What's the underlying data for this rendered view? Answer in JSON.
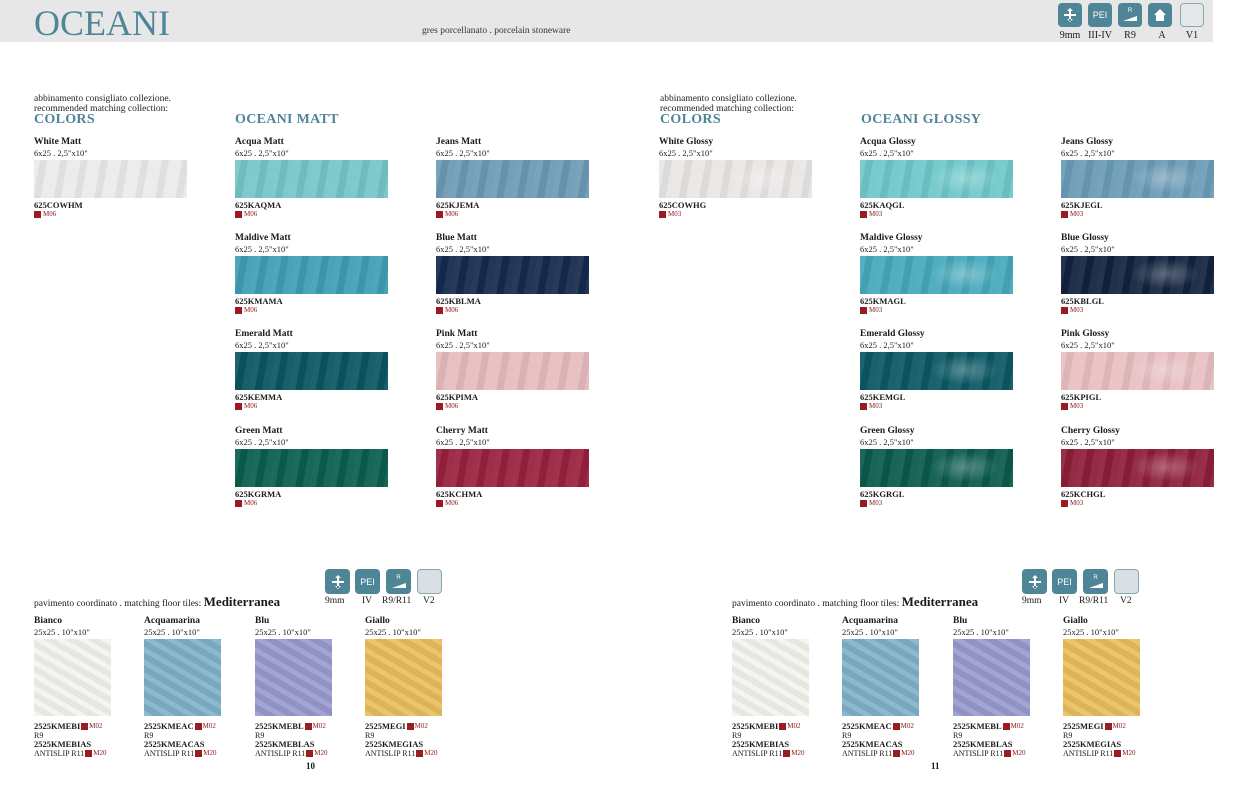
{
  "header": {
    "brand": "OCEANI",
    "subtitle": "gres porcellanato . porcelain stoneware",
    "specs": [
      {
        "icon": "thickness-icon",
        "label": "9mm"
      },
      {
        "icon": "pei-icon",
        "text": "PEI",
        "label": "III-IV"
      },
      {
        "icon": "slip-resistance-icon",
        "text": "R",
        "label": "R9"
      },
      {
        "icon": "frost-resistance-icon",
        "label": "A"
      },
      {
        "icon": "shade-variation-icon",
        "label": "V1"
      }
    ]
  },
  "left": {
    "suggest_line1": "abbinamento consigliato collezione.",
    "suggest_line2": "recommended matching collection:",
    "colors_title": "COLORS",
    "series_title": "OCEANI  MATT",
    "colors_tile": {
      "name": "White Matt",
      "size": "6x25 . 2,5\"x10\"",
      "code": "625COWHM",
      "finish": "M06",
      "color": "#ecebea"
    },
    "tiles": [
      {
        "name": "Acqua Matt",
        "size": "6x25 . 2,5\"x10\"",
        "code": "625KAQMA",
        "finish": "M06",
        "color": "#75c6c9"
      },
      {
        "name": "Jeans Matt",
        "size": "6x25 . 2,5\"x10\"",
        "code": "625KJEMA",
        "finish": "M06",
        "color": "#6e9ab5"
      },
      {
        "name": "Maldive Matt",
        "size": "6x25 . 2,5\"x10\"",
        "code": "625KMAMA",
        "finish": "M06",
        "color": "#3e9eb4"
      },
      {
        "name": "Blue Matt",
        "size": "6x25 . 2,5\"x10\"",
        "code": "625KBLMA",
        "finish": "M06",
        "color": "#16294e"
      },
      {
        "name": "Emerald Matt",
        "size": "6x25 . 2,5\"x10\"",
        "code": "625KEMMA",
        "finish": "M06",
        "color": "#0b5562"
      },
      {
        "name": "Pink Matt",
        "size": "6x25 . 2,5\"x10\"",
        "code": "625KPIMA",
        "finish": "M06",
        "color": "#e6bcbd"
      },
      {
        "name": "Green Matt",
        "size": "6x25 . 2,5\"x10\"",
        "code": "625KGRMA",
        "finish": "M06",
        "color": "#0a5e4f"
      },
      {
        "name": "Cherry Matt",
        "size": "6x25 . 2,5\"x10\"",
        "code": "625KCHMA",
        "finish": "M06",
        "color": "#99213f"
      }
    ]
  },
  "right": {
    "suggest_line1": "abbinamento consigliato collezione.",
    "suggest_line2": "recommended matching collection:",
    "colors_title": "COLORS",
    "series_title": "OCEANI  GLOSSY",
    "colors_tile": {
      "name": "White Glossy",
      "size": "6x25 . 2,5\"x10\"",
      "code": "625COWHG",
      "finish": "M03",
      "color": "#e9e7e5"
    },
    "tiles": [
      {
        "name": "Acqua Glossy",
        "size": "6x25 . 2,5\"x10\"",
        "code": "625KAQGL",
        "finish": "M03",
        "color": "#6fc8ca"
      },
      {
        "name": "Jeans Glossy",
        "size": "6x25 . 2,5\"x10\"",
        "code": "625KJEGL",
        "finish": "M03",
        "color": "#6b9bb6"
      },
      {
        "name": "Maldive Glossy",
        "size": "6x25 . 2,5\"x10\"",
        "code": "625KMAGL",
        "finish": "M03",
        "color": "#46a9bb"
      },
      {
        "name": "Blue Glossy",
        "size": "6x25 . 2,5\"x10\"",
        "code": "625KBLGL",
        "finish": "M03",
        "color": "#12233f"
      },
      {
        "name": "Emerald Glossy",
        "size": "6x25 . 2,5\"x10\"",
        "code": "625KEMGL",
        "finish": "M03",
        "color": "#0a5764"
      },
      {
        "name": "Pink Glossy",
        "size": "6x25 . 2,5\"x10\"",
        "code": "625KPIGL",
        "finish": "M03",
        "color": "#e8bfc2"
      },
      {
        "name": "Green Glossy",
        "size": "6x25 . 2,5\"x10\"",
        "code": "625KGRGL",
        "finish": "M03",
        "color": "#0a5a4c"
      },
      {
        "name": "Cherry Glossy",
        "size": "6x25 . 2,5\"x10\"",
        "code": "625KCHGL",
        "finish": "M03",
        "color": "#8e1d3a"
      }
    ]
  },
  "floor": {
    "caption": "pavimento coordinato . matching floor tiles:",
    "collection": "Mediterranea",
    "specs": [
      {
        "icon": "thickness-icon",
        "label": "9mm"
      },
      {
        "icon": "pei-icon",
        "text": "PEI",
        "label": "IV"
      },
      {
        "icon": "slip-resistance-icon",
        "text": "R",
        "label": "R9/R11"
      },
      {
        "icon": "shade-variation-icon",
        "label": "V2"
      }
    ],
    "tiles": [
      {
        "name": "Bianco",
        "size": "25x25 . 10\"x10\"",
        "code": "2525KMEBI",
        "finish": "M02",
        "r": "R9",
        "anti_code": "2525KMEBIAS",
        "anti_label": "ANTISLIP R11",
        "anti_finish": "M20",
        "color": "#f3f3ee"
      },
      {
        "name": "Acquamarina",
        "size": "25x25 . 10\"x10\"",
        "code": "2525KMEAC",
        "finish": "M02",
        "r": "R9",
        "anti_code": "2525KMEACAS",
        "anti_label": "ANTISLIP R11",
        "anti_finish": "M20",
        "color": "#7fb1c8"
      },
      {
        "name": "Blu",
        "size": "25x25 . 10\"x10\"",
        "code": "2525KMEBL",
        "finish": "M02",
        "r": "R9",
        "anti_code": "2525KMEBLAS",
        "anti_label": "ANTISLIP R11",
        "anti_finish": "M20",
        "color": "#9999cf"
      },
      {
        "name": "Giallo",
        "size": "25x25 . 10\"x10\"",
        "code": "2525MEGI",
        "finish": "M02",
        "r": "R9",
        "anti_code": "2525KMEGIAS",
        "anti_label": "ANTISLIP R11",
        "anti_finish": "M20",
        "color": "#e9bd5c"
      }
    ]
  },
  "pages": {
    "left": "10",
    "right": "11"
  }
}
